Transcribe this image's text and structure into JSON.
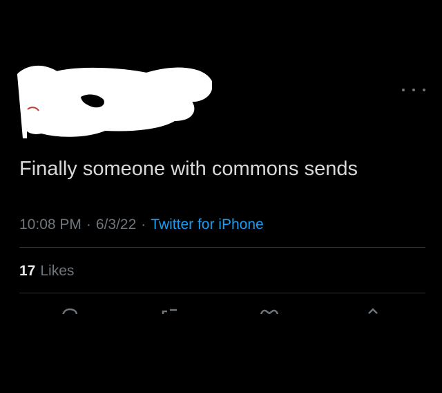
{
  "header": {
    "more_icon": "more-horizontal-icon"
  },
  "tweet": {
    "text": "Finally someone with commons sends",
    "time": "10:08 PM",
    "separator": "·",
    "date": "6/3/22",
    "source": "Twitter for iPhone"
  },
  "stats": {
    "likes_count": "17",
    "likes_label": "Likes"
  },
  "actions": [
    "reply-icon",
    "retweet-icon",
    "like-icon",
    "share-icon"
  ],
  "colors": {
    "background": "#000000",
    "text": "#d9d9d9",
    "secondary": "#6e767d",
    "link": "#1d9bf0",
    "divider": "#2f3336"
  }
}
